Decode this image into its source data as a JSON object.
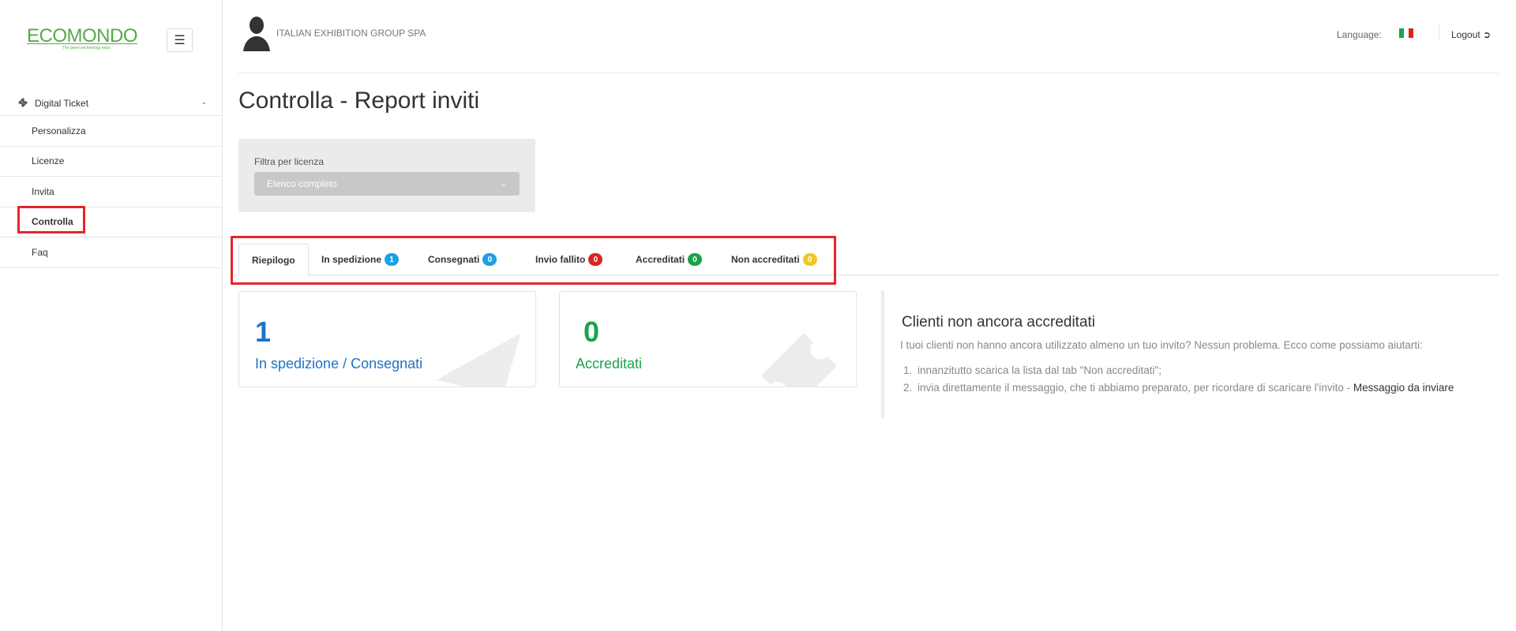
{
  "sidebar": {
    "brand": "ECOMONDO",
    "brand_tagline": "The green technology expo",
    "parent_label": "Digital Ticket",
    "items": [
      {
        "label": "Personalizza"
      },
      {
        "label": "Licenze"
      },
      {
        "label": "Invita"
      },
      {
        "label": "Controlla"
      },
      {
        "label": "Faq"
      }
    ],
    "active_item": "Controlla"
  },
  "header": {
    "company": "ITALIAN EXHIBITION GROUP SPA",
    "language_label": "Language:",
    "logout_label": "Logout"
  },
  "page": {
    "title": "Controlla - Report inviti"
  },
  "filter": {
    "label": "Filtra per licenza",
    "selected": "Elenco completo"
  },
  "tabs": [
    {
      "label": "Riepilogo",
      "badge": null
    },
    {
      "label": "In spedizione",
      "badge": "1"
    },
    {
      "label": "Consegnati",
      "badge": "0"
    },
    {
      "label": "Invio fallito",
      "badge": "0"
    },
    {
      "label": "Accreditati",
      "badge": "0"
    },
    {
      "label": "Non accreditati",
      "badge": "0"
    }
  ],
  "cards": [
    {
      "value": "1",
      "label": "In spedizione / Consegnati"
    },
    {
      "value": "0",
      "label": "Accreditati"
    }
  ],
  "info": {
    "title": "Clienti non ancora accreditati",
    "text": "I tuoi clienti non hanno ancora utilizzato almeno un tuo invito? Nessun problema. Ecco come possiamo aiutarti:",
    "steps": [
      {
        "n": "1.",
        "text": "innanzitutto scarica la lista dal tab \"Non accreditati\";"
      },
      {
        "n": "2.",
        "text": "invia direttamente il messaggio, che ti abbiamo preparato, per ricordare di scaricare l'invito - ",
        "link": "Messaggio da inviare"
      }
    ]
  },
  "colors": {
    "brand_green": "#58a84a",
    "badge_blue": "#1da1e2",
    "badge_red": "#d9261c",
    "badge_green": "#1aa34a",
    "badge_yellow": "#f3c624",
    "card_blue": "#1d74c6",
    "card_green": "#1aa34a",
    "highlight_red": "#e4262b"
  },
  "icons": {
    "menu": "hamburger-icon",
    "ticket": "ticket-icon",
    "chevron": "chevron-down-icon",
    "user": "user-silhouette-icon",
    "flag": "italy-flag-icon",
    "logout": "logout-icon"
  }
}
